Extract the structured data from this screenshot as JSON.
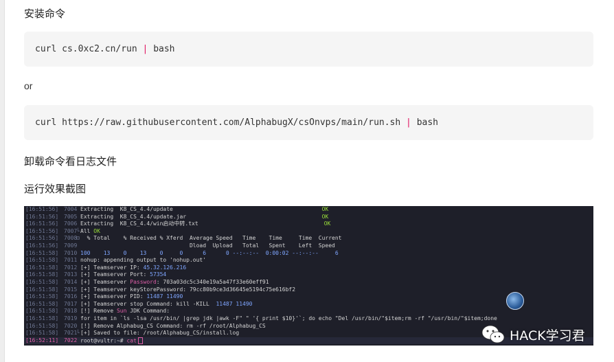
{
  "sections": {
    "install_heading": "安装命令",
    "install_cmd_before": "curl cs.0xc2.cn/run ",
    "install_cmd_pipe": "|",
    "install_cmd_after": " bash",
    "or_text": "or",
    "alt_cmd_before": "curl https://raw.githubusercontent.com/AlphabugX/csOnvps/main/run.sh ",
    "alt_cmd_pipe": "|",
    "alt_cmd_after": " bash",
    "uninstall_heading": "卸载命令看日志文件",
    "result_heading": "运行效果截图"
  },
  "terminal": {
    "lines": [
      {
        "ts": "[16:51:56]",
        "ln": "7004",
        "gut": "",
        "text": "Extracting  K8_CS_4.4/update                                             ",
        "ok": "OK"
      },
      {
        "ts": "[16:51:56]",
        "ln": "7005",
        "gut": "",
        "text": "Extracting  K8_CS_4.4/update.jar                                         ",
        "ok": "OK"
      },
      {
        "ts": "[16:51:56]",
        "ln": "7006",
        "gut": "",
        "text": "Extracting  K8_CS_4.4/win启动中转.txt                                      ",
        "ok": "OK"
      },
      {
        "ts": "[16:51:56]",
        "ln": "7007",
        "gut": "└",
        "text": "All ",
        "ok": "OK"
      },
      {
        "ts": "[16:51:56]",
        "ln": "7008",
        "gut": "⊟",
        "text": "  % Total    % Received % Xferd  Average Speed   Time    Time     Time  Current",
        "ok": ""
      },
      {
        "ts": "[16:51:56]",
        "ln": "7009",
        "gut": "",
        "text": "                                 Dload  Upload   Total   Spent    Left  Speed",
        "ok": ""
      },
      {
        "ts": "[16:51:58]",
        "ln": "7010",
        "gut": "",
        "text": "100    13    0    13    0     0      6      0 --:--:--  0:00:02 --:--:--     6",
        "ok": ""
      },
      {
        "ts": "[16:51:58]",
        "ln": "7011",
        "gut": "",
        "text": "nohup: appending output to 'nohup.out'",
        "ok": ""
      },
      {
        "ts": "[16:51:58]",
        "ln": "7012",
        "gut": "",
        "text": "[+] Teamserver IP: ",
        "ok": "",
        "val": "45.32.126.216"
      },
      {
        "ts": "[16:51:58]",
        "ln": "7013",
        "gut": "",
        "text": "[+] Teamserver Port: ",
        "ok": "",
        "val": "57354"
      },
      {
        "ts": "[16:51:58]",
        "ln": "7014",
        "gut": "",
        "text": "[+] Teamserver ",
        "ok": "",
        "val": "Password",
        "rest": ": 703a03dc5c340e19a5a47f33e60eff91"
      },
      {
        "ts": "[16:51:58]",
        "ln": "7015",
        "gut": "",
        "text": "[+] Teamserver keyStorePassword: 79cc80b9ce3d36645e5194c75e616bf2",
        "ok": ""
      },
      {
        "ts": "[16:51:58]",
        "ln": "7016",
        "gut": "",
        "text": "[+] Teamserver PID: ",
        "ok": "",
        "val": "11487 11490"
      },
      {
        "ts": "[16:51:58]",
        "ln": "7017",
        "gut": "",
        "text": "[+] Teamserver stop Command: kill -KILL  ",
        "ok": "",
        "val": "11487 11490"
      },
      {
        "ts": "[16:51:58]",
        "ln": "7018",
        "gut": "",
        "text": "[!] Remove ",
        "ok": "",
        "val": "Sun",
        "rest": " JDK Command:"
      },
      {
        "ts": "[16:51:58]",
        "ln": "7019",
        "gut": "",
        "text": "for item in `ls -lsa /usr/bin/ |grep jdk |awk -F\" \" '{ print $10}'`; do echo \"Del /usr/bin/\"$item;rm -rf \"/usr/bin/\"$item;done",
        "ok": ""
      },
      {
        "ts": "[16:51:58]",
        "ln": "7020",
        "gut": "",
        "text": "[!] Remove Alphabug_CS Command: rm -rf /root/Alphabug_CS",
        "ok": ""
      },
      {
        "ts": "[16:51:58]",
        "ln": "7021",
        "gut": "└",
        "text": "[+] Saved to file: /root/Alphabug_CS/install.log",
        "ok": ""
      },
      {
        "ts": "[16:52:11]",
        "ln": "7022",
        "gut": "",
        "text": "root@vultr:~# ",
        "ok": "",
        "val": "cat",
        "cursor": true
      }
    ]
  },
  "watermark": {
    "text": "HACK学习君",
    "icon": "wechat-icon"
  },
  "colors": {
    "terminal_bg": "#1e1f29",
    "ok_green": "#9adf3a",
    "highlight_pink": "#e05fa8",
    "value_blue": "#7fa6ff",
    "pipe_red": "#e0115f"
  }
}
